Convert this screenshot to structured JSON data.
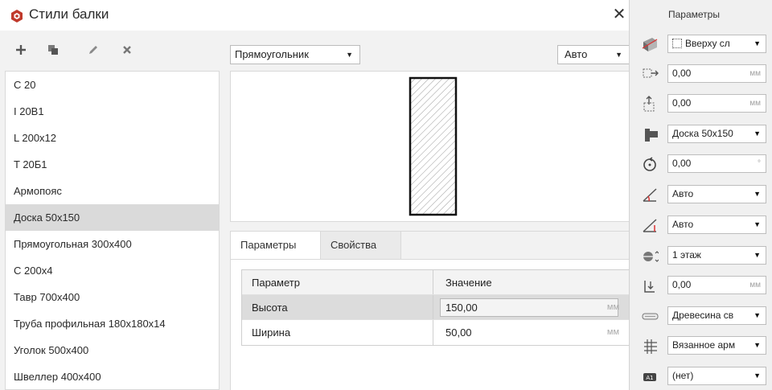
{
  "dialog": {
    "title": "Стили балки",
    "close_symbol": "✕",
    "toolbar": [
      {
        "name": "add-button",
        "icon": "plus-icon"
      },
      {
        "name": "duplicate-button",
        "icon": "copy-icon"
      },
      {
        "name": "edit-button",
        "icon": "pencil-icon"
      },
      {
        "name": "delete-button",
        "icon": "cross-icon"
      }
    ],
    "styles": [
      "С 20",
      "I 20B1",
      "L 200x12",
      "T 20Б1",
      "Армопояс",
      "Доска 50x150",
      "Прямоугольная 300x400",
      "С 200x4",
      "Тавр 700x400",
      "Труба профильная 180x180x14",
      "Уголок 500x400",
      "Швеллер 400x400"
    ],
    "selected_style": "Доска 50x150",
    "shape_select": "Прямоугольник",
    "auto_select": "Авто",
    "tabs": [
      "Параметры",
      "Свойства"
    ],
    "active_tab": "Параметры",
    "grid": {
      "headers": [
        "Параметр",
        "Значение"
      ],
      "rows": [
        {
          "param": "Высота",
          "value": "150,00",
          "unit": "мм"
        },
        {
          "param": "Ширина",
          "value": "50,00",
          "unit": "мм"
        }
      ]
    }
  },
  "properties": {
    "title": "Параметры",
    "rows": [
      {
        "icon": "beam-3d-icon",
        "value": "Вверху сл",
        "kind": "select",
        "sub_icon": "grid-align-icon"
      },
      {
        "icon": "offset-horizontal-icon",
        "value": "0,00",
        "kind": "number",
        "unit": "мм"
      },
      {
        "icon": "offset-vertical-icon",
        "value": "0,00",
        "kind": "number",
        "unit": "мм"
      },
      {
        "icon": "beam-profile-icon",
        "value": "Доска 50x150",
        "kind": "select"
      },
      {
        "icon": "rotation-icon",
        "value": "0,00",
        "kind": "number",
        "unit": "°"
      },
      {
        "icon": "start-angle-icon",
        "value": "Авто",
        "kind": "select"
      },
      {
        "icon": "end-angle-icon",
        "value": "Авто",
        "kind": "select"
      },
      {
        "icon": "level-icon",
        "value": "1 этаж",
        "kind": "select"
      },
      {
        "icon": "elevation-icon",
        "value": "0,00",
        "kind": "number",
        "unit": "мм"
      },
      {
        "icon": "material-icon",
        "value": "Древесина св",
        "kind": "select"
      },
      {
        "icon": "reinforcement-icon",
        "value": "Вязанное арм",
        "kind": "select"
      },
      {
        "icon": "label-tag-icon",
        "value": "(нет)",
        "kind": "select"
      }
    ]
  },
  "colors": {
    "accent_red": "#c0392b",
    "selection": "#dadada"
  }
}
